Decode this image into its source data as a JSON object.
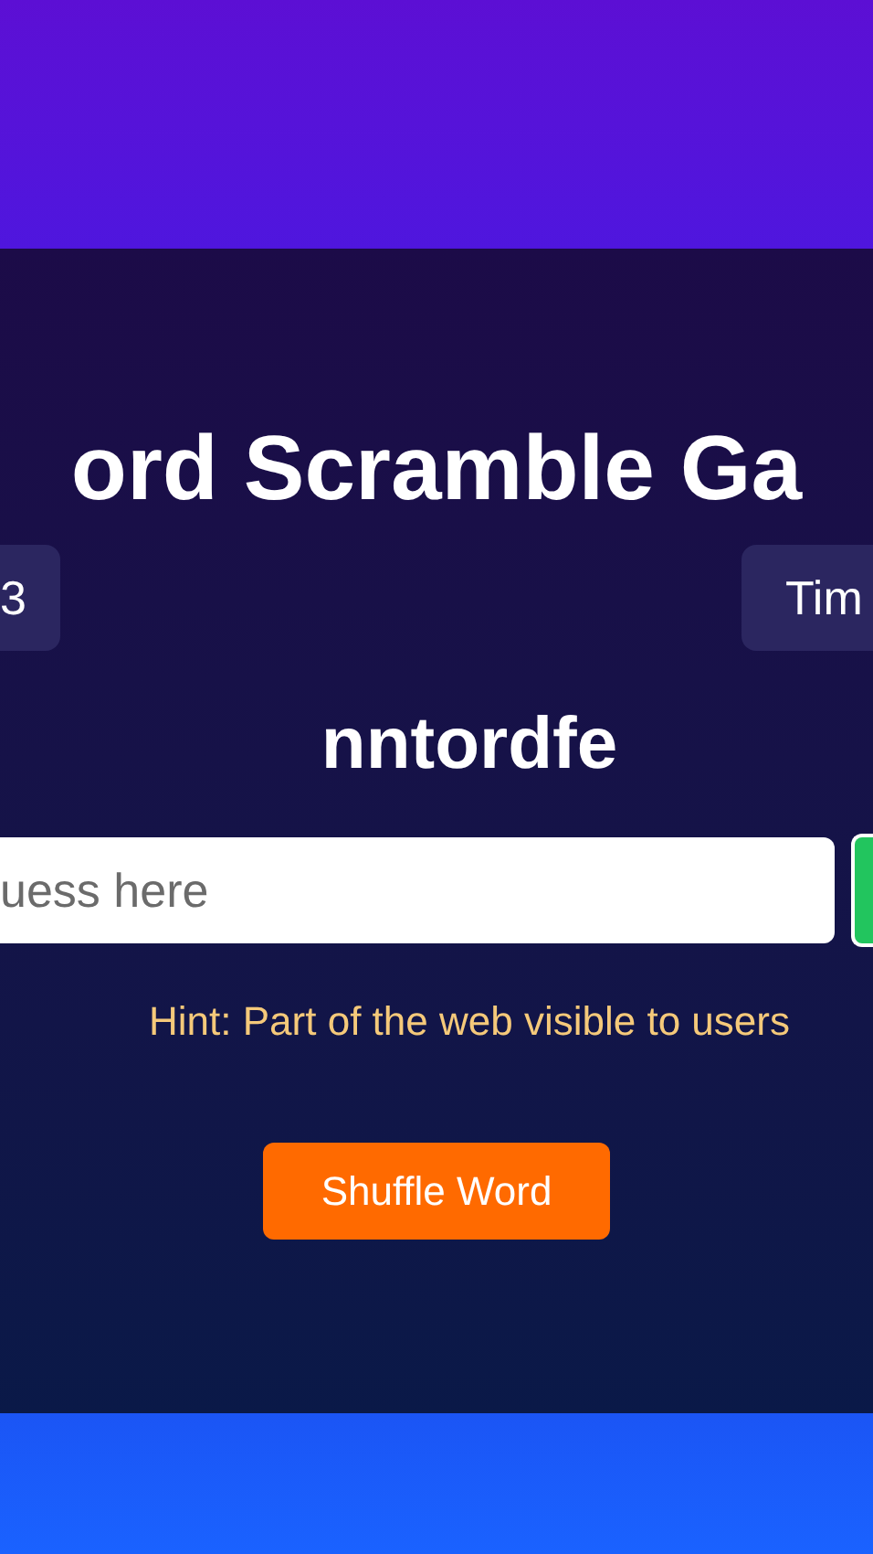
{
  "title": "ord Scramble Ga",
  "stats": [
    {
      "text": "3"
    },
    {
      "text": "Tim"
    }
  ],
  "scrambled_word": "nntordfe",
  "guess_input": {
    "placeholder": "uess here"
  },
  "hint": "Hint: Part of the web visible to users",
  "shuffle_button": "Shuffle Word"
}
